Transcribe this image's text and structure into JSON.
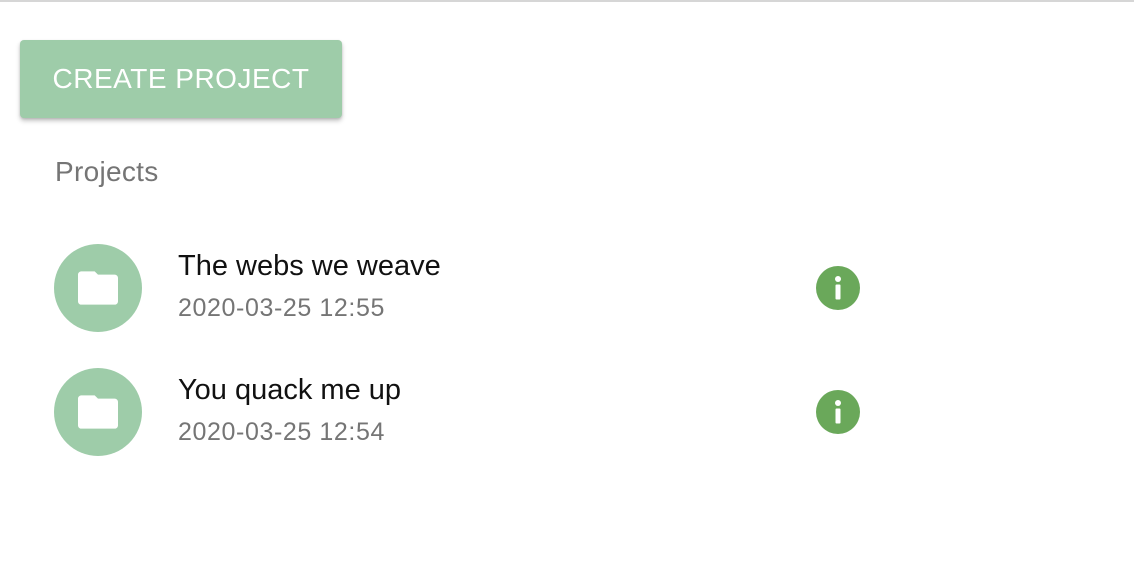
{
  "toolbar": {
    "create_label": "CREATE PROJECT"
  },
  "section": {
    "title": "Projects"
  },
  "projects": [
    {
      "name": "The webs we weave",
      "date": "2020-03-25 12:55",
      "icon": "folder-icon",
      "action_icon": "info-icon"
    },
    {
      "name": "You quack me up",
      "date": "2020-03-25 12:54",
      "icon": "folder-icon",
      "action_icon": "info-icon"
    }
  ],
  "colors": {
    "primary_light": "#9ecca9",
    "info": "#6aa85a",
    "secondary_text": "#757575",
    "primary_text": "#111111"
  }
}
